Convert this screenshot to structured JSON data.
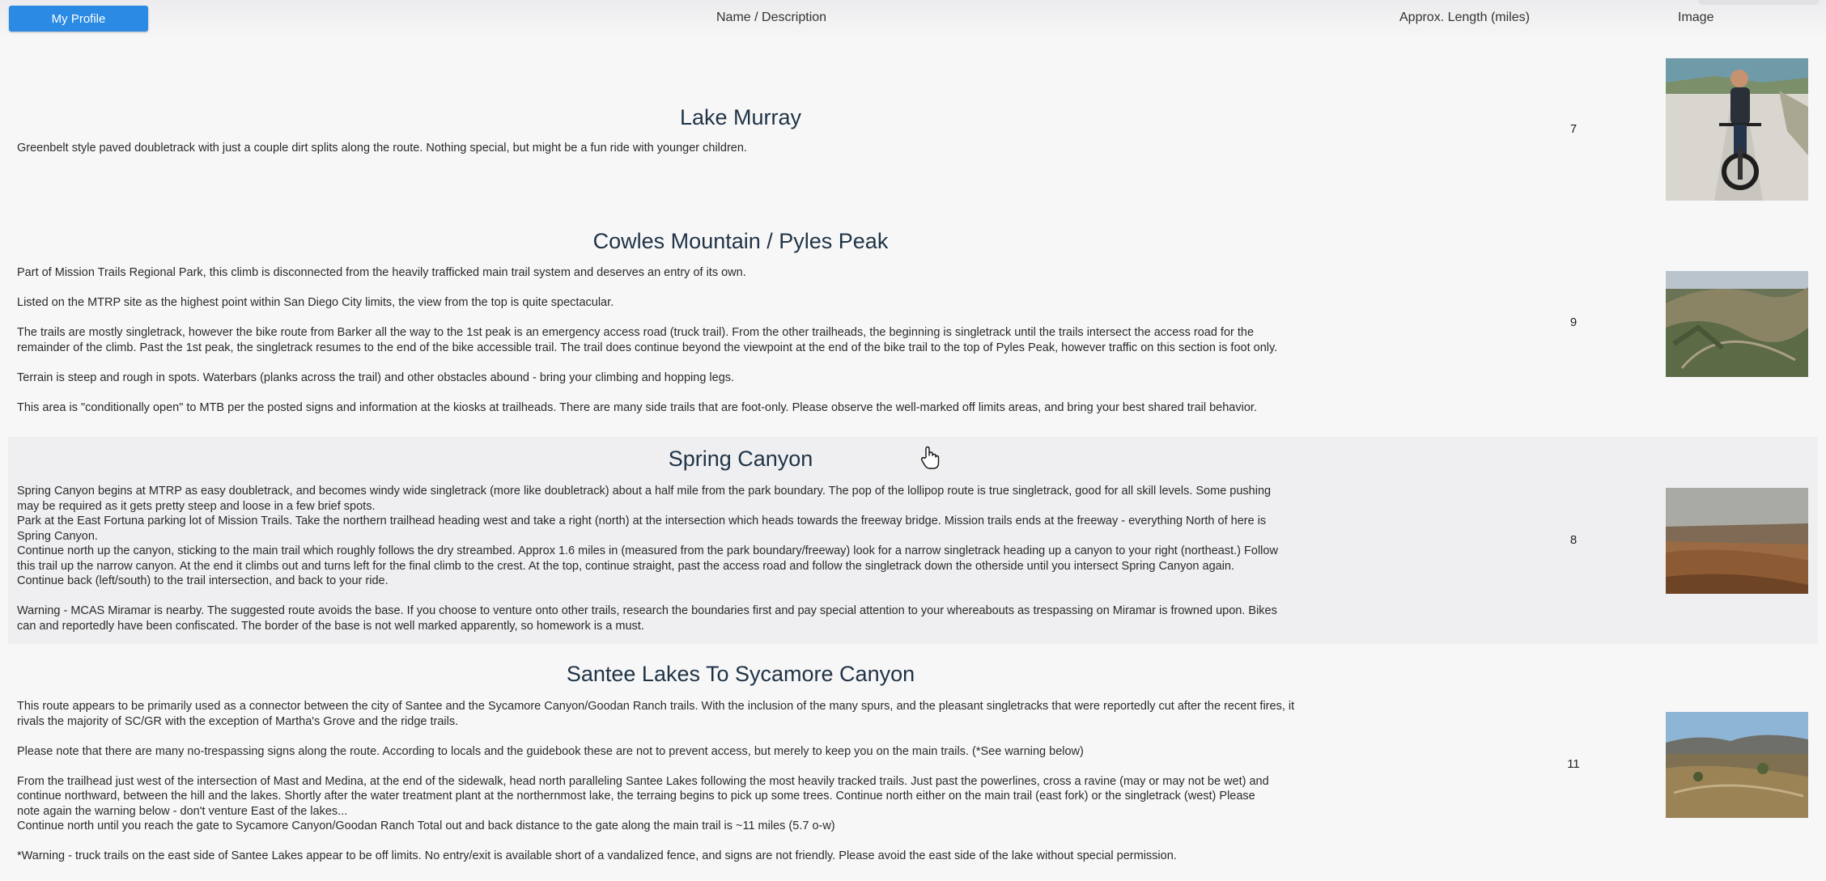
{
  "header": {
    "profile_button": "My Profile",
    "columns": {
      "name": "Name / Description",
      "length": "Approx. Length (miles)",
      "image": "Image"
    }
  },
  "trails": [
    {
      "title": "Lake Murray",
      "length": "7",
      "image_icon": "photo-icon",
      "paragraphs": [
        "Greenbelt style paved doubletrack with just a couple dirt splits along the route. Nothing special, but might be a fun ride with younger children."
      ]
    },
    {
      "title": "Cowles Mountain / Pyles Peak",
      "length": "9",
      "image_icon": "photo-icon",
      "paragraphs": [
        "Part of Mission Trails Regional Park, this climb is disconnected from the heavily trafficked main trail system and deserves an entry of its own.",
        "Listed on the MTRP site as the highest point within San Diego City limits, the view from the top is quite spectacular.",
        "The trails are mostly singletrack, however the bike route from Barker all the way to the 1st peak is an emergency access road (truck trail). From the other trailheads, the beginning is singletrack until the trails intersect the access road for the\nremainder of the climb. Past the 1st peak, the singletrack resumes to the end of the bike accessible trail. The trail does continue beyond the viewpoint at the end of the bike trail to the top of Pyles Peak, however traffic on this section is foot only.",
        "Terrain is steep and rough in spots. Waterbars (planks across the trail) and other obstacles abound - bring your climbing and hopping legs.",
        "This area is \"conditionally open\" to MTB per the posted signs and information at the kiosks at trailheads. There are many side trails that are foot-only. Please observe the well-marked off limits areas, and bring your best shared trail behavior."
      ]
    },
    {
      "title": "Spring Canyon",
      "length": "8",
      "image_icon": "photo-icon",
      "paragraphs": [
        "Spring Canyon begins at MTRP as easy doubletrack, and becomes windy wide singletrack (more like doubletrack) about a half mile from the park boundary. The pop of the lollipop route is true singletrack, good for all skill levels. Some pushing\nmay be required as it gets pretty steep and loose in a few brief spots.\nPark at the East Fortuna parking lot of Mission Trails. Take the northern trailhead heading west and take a right (north) at the intersection which heads towards the freeway bridge. Mission trails ends at the freeway - everything North of here is\nSpring Canyon.\nContinue north up the canyon, sticking to the main trail which roughly follows the dry streambed. Approx 1.6 miles in (measured from the park boundary/freeway) look for a narrow singletrack heading up a canyon to your right (northeast.) Follow\nthis trail up the narrow canyon. At the end it climbs out and turns left for the final climb to the crest. At the top, continue straight, past the access road and follow the singletrack down the otherside until you intersect Spring Canyon again.\nContinue back (left/south) to the trail intersection, and back to your ride.",
        "Warning - MCAS Miramar is nearby. The suggested route avoids the base. If you choose to venture onto other trails, research the boundaries first and pay special attention to your whereabouts as trespassing on Miramar is frowned upon. Bikes\ncan and reportedly have been confiscated. The border of the base is not well marked apparently, so homework is a must."
      ]
    },
    {
      "title": "Santee Lakes To Sycamore Canyon",
      "length": "11",
      "image_icon": "photo-icon",
      "paragraphs": [
        "This route appears to be primarily used as a connector between the city of Santee and the Sycamore Canyon/Goodan Ranch trails. With the inclusion of the many spurs, and the pleasant singletracks that were reportedly cut after the recent fires, it\nrivals the majority of SC/GR with the exception of Martha's Grove and the ridge trails.",
        "Please note that there are many no-trespassing signs along the route. According to locals and the guidebook these are not to prevent access, but merely to keep you on the main trails. (*See warning below)",
        "From the trailhead just west of the intersection of Mast and Medina, at the end of the sidewalk, head north paralleling Santee Lakes following the most heavily tracked trails. Just past the powerlines, cross a ravine (may or may not be wet) and\ncontinue northward, between the hill and the lakes. Shortly after the water treatment plant at the northernmost lake, the terraing begins to pick up some trees. Continue north either on the main trail (east fork) or the singletrack (west) Please\nnote again the warning below - don't venture East of the lakes...\nContinue north until you reach the gate to Sycamore Canyon/Goodan Ranch Total out and back distance to the gate along the main trail is ~11 miles (5.7 o-w)",
        "*Warning - truck trails on the east side of Santee Lakes appear to be off limits. No entry/exit is available short of a vandalized fence, and signs are not friendly. Please avoid the east side of the lake without special permission."
      ]
    }
  ]
}
